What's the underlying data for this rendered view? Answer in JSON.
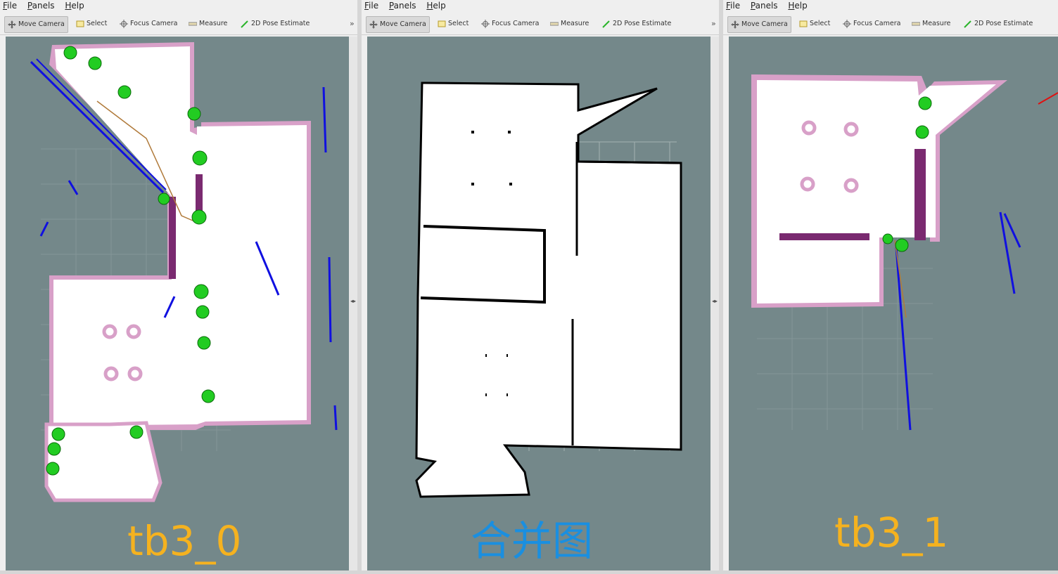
{
  "windows": [
    {
      "menu": [
        "File",
        "Panels",
        "Help"
      ],
      "tools": [
        "Move Camera",
        "Select",
        "Focus Camera",
        "Measure",
        "2D Pose Estimate"
      ],
      "overflow": "»",
      "caption": "tb3_0",
      "caption_color": "#f5b21f"
    },
    {
      "menu": [
        "File",
        "Panels",
        "Help"
      ],
      "tools": [
        "Move Camera",
        "Select",
        "Focus Camera",
        "Measure",
        "2D Pose Estimate"
      ],
      "overflow": "»",
      "caption": "合并图",
      "caption_color": "#1a8fe0"
    },
    {
      "menu": [
        "File",
        "Panels",
        "Help"
      ],
      "tools": [
        "Move Camera",
        "Select",
        "Focus Camera",
        "Measure",
        "2D Pose Estimate"
      ],
      "overflow": "»",
      "caption": "tb3_1",
      "caption_color": "#f5b21f"
    }
  ],
  "colors": {
    "background": "#74888a",
    "free_space": "#ffffff",
    "costmap": "#d8a0c8",
    "inflation": "#7a2a70",
    "laser": "#1010e0",
    "waypoint": "#22cc22",
    "path": "#b07a3a"
  }
}
